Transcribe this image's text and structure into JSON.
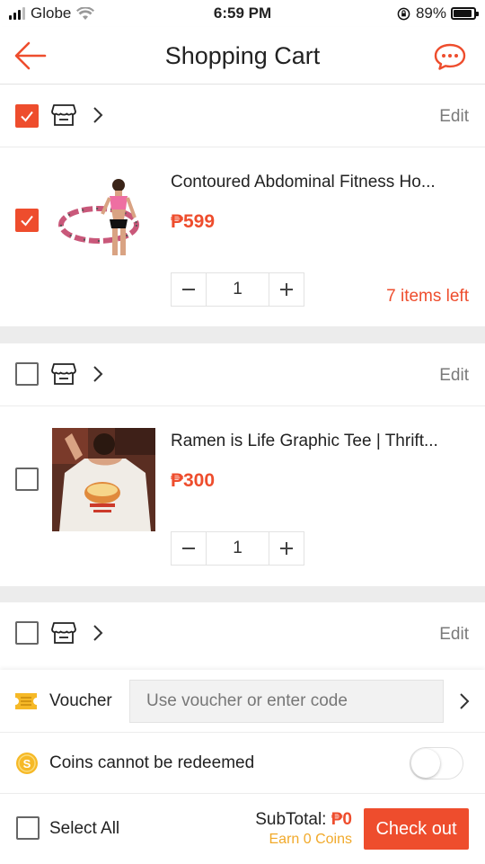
{
  "status_bar": {
    "carrier": "Globe",
    "time": "6:59 PM",
    "battery_percent": "89%",
    "battery_level": 0.89
  },
  "header": {
    "title": "Shopping Cart",
    "back_icon": "arrow-left-icon",
    "chat_icon": "chat-bubble-icon"
  },
  "accent_color": "#ee4d2d",
  "cart": {
    "shops": [
      {
        "checked": true,
        "edit_label": "Edit",
        "item": {
          "name": "Contoured Abdominal Fitness Ho...",
          "price": "₱599",
          "quantity": "1",
          "stock_note": "7 items left",
          "checked": true
        }
      },
      {
        "checked": false,
        "edit_label": "Edit",
        "item": {
          "name": "Ramen is Life Graphic Tee | Thrift...",
          "price": "₱300",
          "quantity": "1",
          "stock_note": "",
          "checked": false
        }
      },
      {
        "checked": false,
        "edit_label": "Edit"
      }
    ]
  },
  "voucher": {
    "label": "Voucher",
    "placeholder": "Use voucher or enter code"
  },
  "coins": {
    "label": "Coins cannot be redeemed",
    "toggle_on": false
  },
  "checkout": {
    "select_all_label": "Select All",
    "subtotal_label": "SubTotal:",
    "subtotal_value": "₱0",
    "earn_coins": "Earn 0 Coins",
    "button_label": "Check out"
  }
}
